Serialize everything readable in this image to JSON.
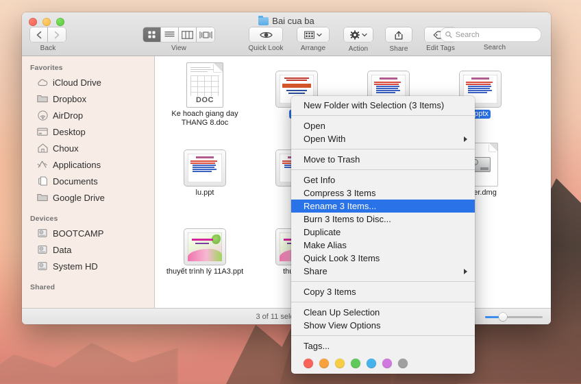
{
  "window": {
    "title": "Bai cua ba",
    "traffic_lights": [
      "close-red",
      "minimize-yellow",
      "zoom-green"
    ]
  },
  "toolbar": {
    "nav": {
      "back_label": "Back",
      "back_icon": "chevron-left-icon",
      "forward_icon": "chevron-right-icon"
    },
    "view": {
      "caption": "View",
      "modes": [
        "icon-view",
        "list-view",
        "column-view",
        "coverflow-view"
      ],
      "selected": "icon-view"
    },
    "quick_look": {
      "label": "Quick Look",
      "icon": "eye-icon"
    },
    "arrange": {
      "label": "Arrange",
      "icon": "grid-icon"
    },
    "action": {
      "label": "Action",
      "icon": "gear-icon"
    },
    "share": {
      "label": "Share",
      "icon": "share-icon"
    },
    "edit_tags": {
      "label": "Edit Tags",
      "icon": "tag-icon"
    },
    "search": {
      "caption": "Search",
      "placeholder": "Search",
      "value": "",
      "icon": "search-icon"
    }
  },
  "sidebar": {
    "sections": [
      {
        "title": "Favorites",
        "items": [
          {
            "label": "iCloud Drive",
            "icon": "cloud-icon"
          },
          {
            "label": "Dropbox",
            "icon": "folder-icon"
          },
          {
            "label": "AirDrop",
            "icon": "airdrop-icon"
          },
          {
            "label": "Desktop",
            "icon": "desktop-icon"
          },
          {
            "label": "Choux",
            "icon": "home-icon"
          },
          {
            "label": "Applications",
            "icon": "applications-icon"
          },
          {
            "label": "Documents",
            "icon": "documents-icon"
          },
          {
            "label": "Google Drive",
            "icon": "folder-icon"
          }
        ]
      },
      {
        "title": "Devices",
        "items": [
          {
            "label": "BOOTCAMP",
            "icon": "harddisk-icon"
          },
          {
            "label": "Data",
            "icon": "harddisk-icon"
          },
          {
            "label": "System HD",
            "icon": "harddisk-icon"
          }
        ]
      },
      {
        "title": "Shared",
        "items": []
      }
    ]
  },
  "files": [
    {
      "name": "Ke hoach giang day THANG 8.doc",
      "kind": "doc",
      "selected": false
    },
    {
      "name": "lí11",
      "kind": "ppt-orange",
      "selected": true
    },
    {
      "name": "",
      "kind": "ppt-text",
      "selected": false
    },
    {
      "name": ".pptx",
      "kind": "ppt-text",
      "selected": true
    },
    {
      "name": "lu.ppt",
      "kind": "ppt-text",
      "selected": false
    },
    {
      "name": "lu",
      "kind": "ppt-text",
      "selected": false
    },
    {
      "name": "",
      "kind": "ppt-text",
      "selected": false
    },
    {
      "name": "ewer.dmg",
      "kind": "dmg",
      "selected": false
    },
    {
      "name": "thuyết trình lý 11A3.ppt",
      "kind": "ppt-green",
      "selected": false
    },
    {
      "name": "thuyết tr",
      "kind": "ppt-green",
      "selected": false
    }
  ],
  "status": {
    "text": "3 of 11 selected, 3"
  },
  "zoom_slider": {
    "value": 28
  },
  "context_menu": {
    "groups": [
      [
        {
          "label": "New Folder with Selection (3 Items)",
          "highlighted": false,
          "submenu": false
        }
      ],
      [
        {
          "label": "Open",
          "highlighted": false,
          "submenu": false
        },
        {
          "label": "Open With",
          "highlighted": false,
          "submenu": true
        }
      ],
      [
        {
          "label": "Move to Trash",
          "highlighted": false,
          "submenu": false
        }
      ],
      [
        {
          "label": "Get Info",
          "highlighted": false,
          "submenu": false
        },
        {
          "label": "Compress 3 Items",
          "highlighted": false,
          "submenu": false
        },
        {
          "label": "Rename 3 Items...",
          "highlighted": true,
          "submenu": false
        },
        {
          "label": "Burn 3 Items to Disc...",
          "highlighted": false,
          "submenu": false
        },
        {
          "label": "Duplicate",
          "highlighted": false,
          "submenu": false
        },
        {
          "label": "Make Alias",
          "highlighted": false,
          "submenu": false
        },
        {
          "label": "Quick Look 3 Items",
          "highlighted": false,
          "submenu": false
        },
        {
          "label": "Share",
          "highlighted": false,
          "submenu": true
        }
      ],
      [
        {
          "label": "Copy 3 Items",
          "highlighted": false,
          "submenu": false
        }
      ],
      [
        {
          "label": "Clean Up Selection",
          "highlighted": false,
          "submenu": false
        },
        {
          "label": "Show View Options",
          "highlighted": false,
          "submenu": false
        }
      ],
      [
        {
          "label": "Tags...",
          "highlighted": false,
          "submenu": false
        }
      ]
    ],
    "tag_colors": [
      "#f9635a",
      "#f7a23d",
      "#f6cd44",
      "#61c95b",
      "#47b3ec",
      "#d07ae0",
      "#a0a0a0"
    ]
  },
  "colors": {
    "accent": "#2a72e8",
    "sidebar_bg": "#f7ece6",
    "selection_blue": "#2a72e8"
  }
}
